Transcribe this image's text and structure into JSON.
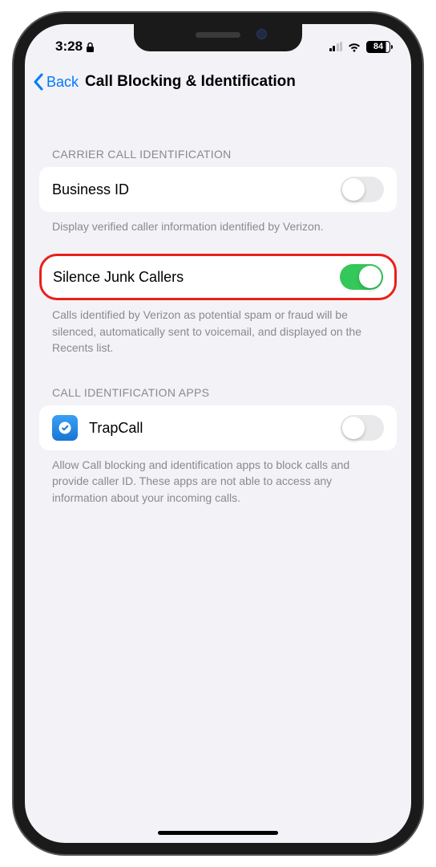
{
  "status": {
    "time": "3:28",
    "battery": "84"
  },
  "nav": {
    "back_label": "Back",
    "title": "Call Blocking & Identification"
  },
  "sections": {
    "carrier": {
      "header": "CARRIER CALL IDENTIFICATION",
      "rows": {
        "business_id": {
          "label": "Business ID",
          "on": false
        },
        "silence_junk": {
          "label": "Silence Junk Callers",
          "on": true
        }
      },
      "footer_business": "Display verified caller information identified by Verizon.",
      "footer_silence": "Calls identified by Verizon as potential spam or fraud will be silenced, automatically sent to voicemail, and displayed on the Recents list."
    },
    "apps": {
      "header": "CALL IDENTIFICATION APPS",
      "rows": {
        "trapcall": {
          "label": "TrapCall",
          "on": false
        }
      },
      "footer": "Allow Call blocking and identification apps to block calls and provide caller ID. These apps are not able to access any information about your incoming calls."
    }
  }
}
